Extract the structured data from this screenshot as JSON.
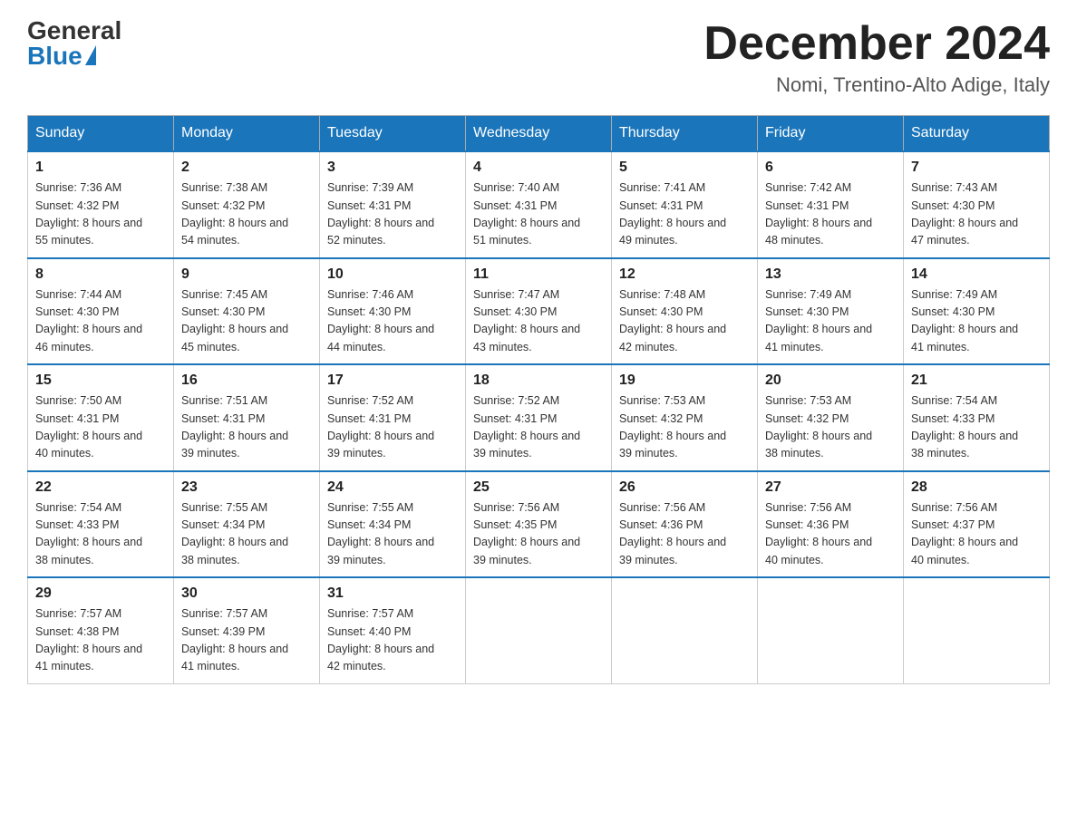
{
  "header": {
    "logo_general": "General",
    "logo_blue": "Blue",
    "month_title": "December 2024",
    "location": "Nomi, Trentino-Alto Adige, Italy"
  },
  "days_of_week": [
    "Sunday",
    "Monday",
    "Tuesday",
    "Wednesday",
    "Thursday",
    "Friday",
    "Saturday"
  ],
  "weeks": [
    [
      {
        "day": "1",
        "sunrise": "Sunrise: 7:36 AM",
        "sunset": "Sunset: 4:32 PM",
        "daylight": "Daylight: 8 hours and 55 minutes."
      },
      {
        "day": "2",
        "sunrise": "Sunrise: 7:38 AM",
        "sunset": "Sunset: 4:32 PM",
        "daylight": "Daylight: 8 hours and 54 minutes."
      },
      {
        "day": "3",
        "sunrise": "Sunrise: 7:39 AM",
        "sunset": "Sunset: 4:31 PM",
        "daylight": "Daylight: 8 hours and 52 minutes."
      },
      {
        "day": "4",
        "sunrise": "Sunrise: 7:40 AM",
        "sunset": "Sunset: 4:31 PM",
        "daylight": "Daylight: 8 hours and 51 minutes."
      },
      {
        "day": "5",
        "sunrise": "Sunrise: 7:41 AM",
        "sunset": "Sunset: 4:31 PM",
        "daylight": "Daylight: 8 hours and 49 minutes."
      },
      {
        "day": "6",
        "sunrise": "Sunrise: 7:42 AM",
        "sunset": "Sunset: 4:31 PM",
        "daylight": "Daylight: 8 hours and 48 minutes."
      },
      {
        "day": "7",
        "sunrise": "Sunrise: 7:43 AM",
        "sunset": "Sunset: 4:30 PM",
        "daylight": "Daylight: 8 hours and 47 minutes."
      }
    ],
    [
      {
        "day": "8",
        "sunrise": "Sunrise: 7:44 AM",
        "sunset": "Sunset: 4:30 PM",
        "daylight": "Daylight: 8 hours and 46 minutes."
      },
      {
        "day": "9",
        "sunrise": "Sunrise: 7:45 AM",
        "sunset": "Sunset: 4:30 PM",
        "daylight": "Daylight: 8 hours and 45 minutes."
      },
      {
        "day": "10",
        "sunrise": "Sunrise: 7:46 AM",
        "sunset": "Sunset: 4:30 PM",
        "daylight": "Daylight: 8 hours and 44 minutes."
      },
      {
        "day": "11",
        "sunrise": "Sunrise: 7:47 AM",
        "sunset": "Sunset: 4:30 PM",
        "daylight": "Daylight: 8 hours and 43 minutes."
      },
      {
        "day": "12",
        "sunrise": "Sunrise: 7:48 AM",
        "sunset": "Sunset: 4:30 PM",
        "daylight": "Daylight: 8 hours and 42 minutes."
      },
      {
        "day": "13",
        "sunrise": "Sunrise: 7:49 AM",
        "sunset": "Sunset: 4:30 PM",
        "daylight": "Daylight: 8 hours and 41 minutes."
      },
      {
        "day": "14",
        "sunrise": "Sunrise: 7:49 AM",
        "sunset": "Sunset: 4:30 PM",
        "daylight": "Daylight: 8 hours and 41 minutes."
      }
    ],
    [
      {
        "day": "15",
        "sunrise": "Sunrise: 7:50 AM",
        "sunset": "Sunset: 4:31 PM",
        "daylight": "Daylight: 8 hours and 40 minutes."
      },
      {
        "day": "16",
        "sunrise": "Sunrise: 7:51 AM",
        "sunset": "Sunset: 4:31 PM",
        "daylight": "Daylight: 8 hours and 39 minutes."
      },
      {
        "day": "17",
        "sunrise": "Sunrise: 7:52 AM",
        "sunset": "Sunset: 4:31 PM",
        "daylight": "Daylight: 8 hours and 39 minutes."
      },
      {
        "day": "18",
        "sunrise": "Sunrise: 7:52 AM",
        "sunset": "Sunset: 4:31 PM",
        "daylight": "Daylight: 8 hours and 39 minutes."
      },
      {
        "day": "19",
        "sunrise": "Sunrise: 7:53 AM",
        "sunset": "Sunset: 4:32 PM",
        "daylight": "Daylight: 8 hours and 39 minutes."
      },
      {
        "day": "20",
        "sunrise": "Sunrise: 7:53 AM",
        "sunset": "Sunset: 4:32 PM",
        "daylight": "Daylight: 8 hours and 38 minutes."
      },
      {
        "day": "21",
        "sunrise": "Sunrise: 7:54 AM",
        "sunset": "Sunset: 4:33 PM",
        "daylight": "Daylight: 8 hours and 38 minutes."
      }
    ],
    [
      {
        "day": "22",
        "sunrise": "Sunrise: 7:54 AM",
        "sunset": "Sunset: 4:33 PM",
        "daylight": "Daylight: 8 hours and 38 minutes."
      },
      {
        "day": "23",
        "sunrise": "Sunrise: 7:55 AM",
        "sunset": "Sunset: 4:34 PM",
        "daylight": "Daylight: 8 hours and 38 minutes."
      },
      {
        "day": "24",
        "sunrise": "Sunrise: 7:55 AM",
        "sunset": "Sunset: 4:34 PM",
        "daylight": "Daylight: 8 hours and 39 minutes."
      },
      {
        "day": "25",
        "sunrise": "Sunrise: 7:56 AM",
        "sunset": "Sunset: 4:35 PM",
        "daylight": "Daylight: 8 hours and 39 minutes."
      },
      {
        "day": "26",
        "sunrise": "Sunrise: 7:56 AM",
        "sunset": "Sunset: 4:36 PM",
        "daylight": "Daylight: 8 hours and 39 minutes."
      },
      {
        "day": "27",
        "sunrise": "Sunrise: 7:56 AM",
        "sunset": "Sunset: 4:36 PM",
        "daylight": "Daylight: 8 hours and 40 minutes."
      },
      {
        "day": "28",
        "sunrise": "Sunrise: 7:56 AM",
        "sunset": "Sunset: 4:37 PM",
        "daylight": "Daylight: 8 hours and 40 minutes."
      }
    ],
    [
      {
        "day": "29",
        "sunrise": "Sunrise: 7:57 AM",
        "sunset": "Sunset: 4:38 PM",
        "daylight": "Daylight: 8 hours and 41 minutes."
      },
      {
        "day": "30",
        "sunrise": "Sunrise: 7:57 AM",
        "sunset": "Sunset: 4:39 PM",
        "daylight": "Daylight: 8 hours and 41 minutes."
      },
      {
        "day": "31",
        "sunrise": "Sunrise: 7:57 AM",
        "sunset": "Sunset: 4:40 PM",
        "daylight": "Daylight: 8 hours and 42 minutes."
      },
      null,
      null,
      null,
      null
    ]
  ]
}
